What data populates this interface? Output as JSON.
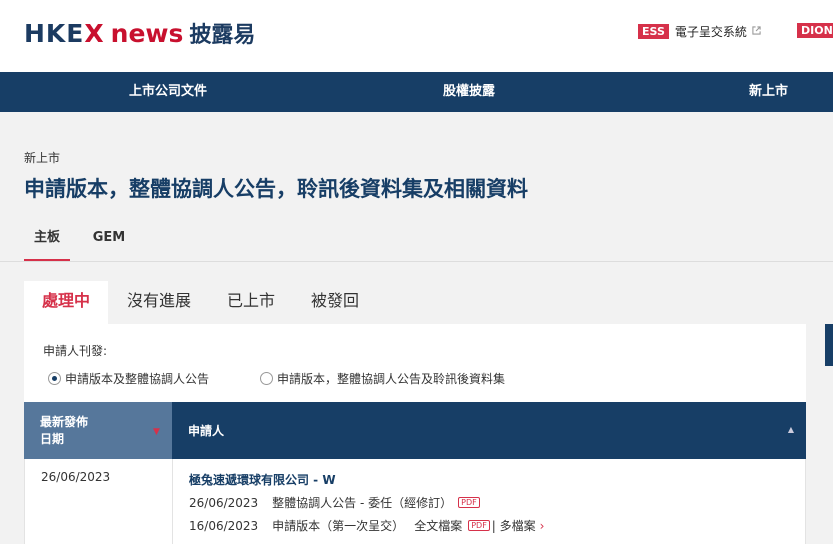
{
  "header": {
    "logo_hkex": "HKE",
    "logo_x": "X",
    "logo_news": "news",
    "logo_cn": "披露易",
    "ess_badge": "ESS",
    "ess_label": "電子呈交系統",
    "ext_icon": "external-link-icon",
    "dion": "DION"
  },
  "nav": {
    "items": [
      "上市公司文件",
      "股權披露",
      "新上市"
    ]
  },
  "breadcrumb": "新上市",
  "page_title": "申請版本，整體協調人公告，聆訊後資料集及相關資料",
  "board_tabs": [
    "主板",
    "GEM"
  ],
  "status_tabs": [
    "處理中",
    "沒有進展",
    "已上市",
    "被發回"
  ],
  "filter": {
    "label": "申請人刊發:",
    "options": [
      "申請版本及整體協調人公告",
      "申請版本，整體協調人公告及聆訊後資料集"
    ],
    "selected": 0
  },
  "table": {
    "col_date_line1": "最新發佈",
    "col_date_line2": "日期",
    "col_applicant": "申請人",
    "sort_desc_icon": "sort-down-icon",
    "sort_asc_icon": "sort-up-icon",
    "rows": [
      {
        "date": "26/06/2023",
        "company": "極兔速遞環球有限公司 - W",
        "doc1_date": "26/06/2023",
        "doc1_title": "整體協調人公告 - 委任（經修訂）",
        "doc2_date": "16/06/2023",
        "doc2_title": "申請版本（第一次呈交）",
        "doc2_full": "全文檔案",
        "doc2_more": "| 多檔案",
        "pdf_label": "PDF",
        "chevron_icon": "chevron-right-icon"
      }
    ]
  },
  "colors": {
    "brand_navy": "#173e66",
    "brand_red": "#d6314a",
    "sorted_col": "#56779b"
  }
}
